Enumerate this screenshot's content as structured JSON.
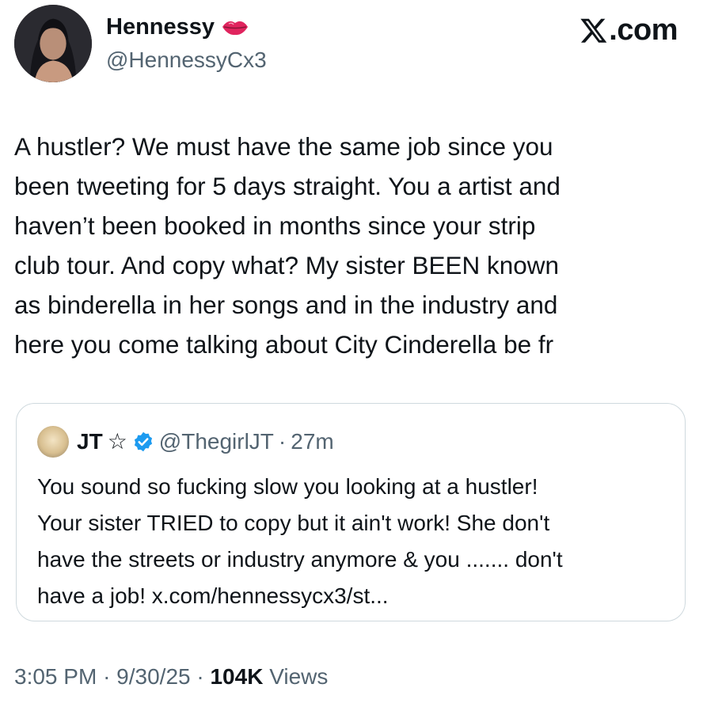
{
  "author": {
    "display_name": "Hennessy",
    "handle": "@HennessyCx3",
    "name_emoji": "lips-icon"
  },
  "brand": {
    "icon": "x-logo-icon",
    "text": ".com"
  },
  "tweet": {
    "text": "A hustler? We must have the same job since you\nbeen tweeting for 5 days straight. You a artist and\nhaven’t been booked in months since your strip\nclub tour.  And copy what? My sister BEEN known\nas binderella in her songs and in the industry and\nhere you come talking about City Cinderella be fr"
  },
  "quoted": {
    "name": "JT",
    "name_symbol": "☆",
    "verified": true,
    "handle": "@ThegirlJT",
    "separator": "·",
    "time": "27m",
    "text": "You sound so fucking slow you looking at a hustler!\nYour sister TRIED to copy but it ain't work! She don't\nhave the streets or industry anymore & you ....... don't\nhave a job! x.com/hennessycx3/st..."
  },
  "meta": {
    "time": "3:05 PM",
    "date": "9/30/25",
    "separator": "·",
    "views_count": "104K",
    "views_label": "Views"
  },
  "colors": {
    "text": "#0f1419",
    "secondary": "#536471",
    "border": "#cfd9de",
    "verified": "#1d9bf0",
    "lips": "#e0245e"
  }
}
